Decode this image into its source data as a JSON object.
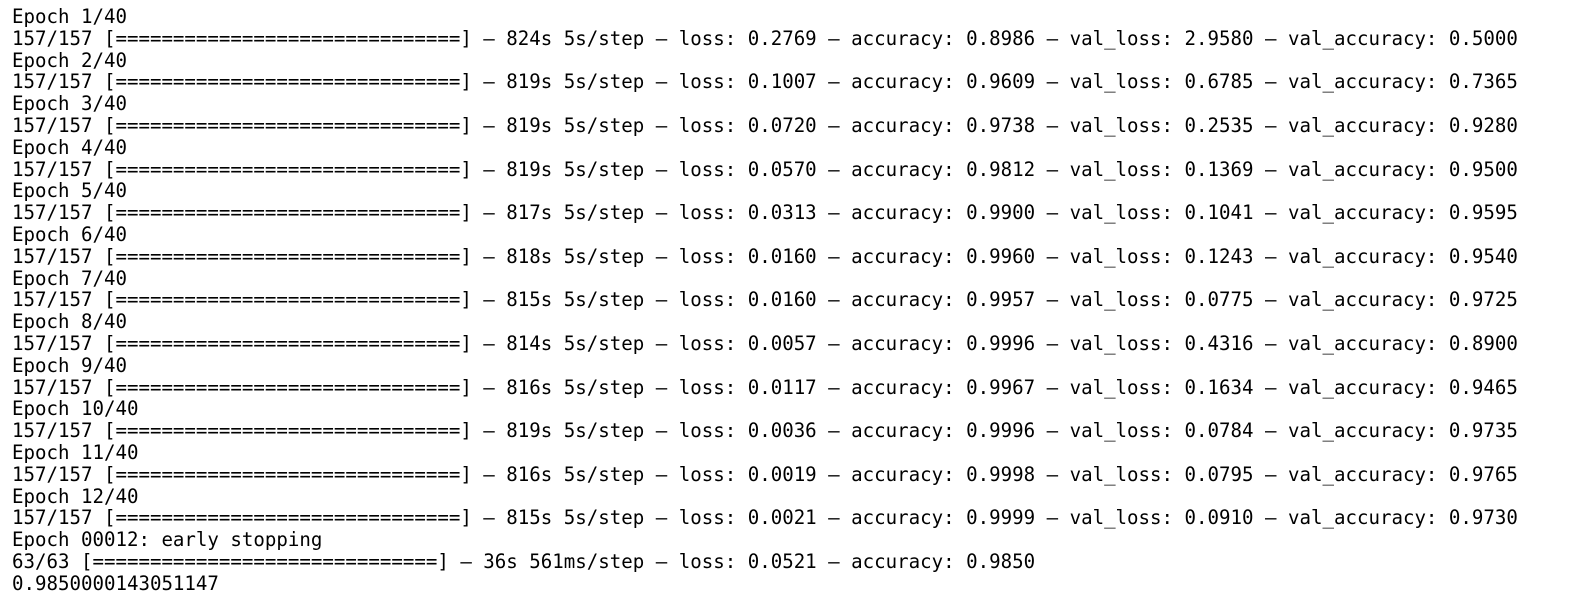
{
  "output": {
    "lines": [
      "Epoch 1/40",
      "157/157 [==============================] – 824s 5s/step – loss: 0.2769 – accuracy: 0.8986 – val_loss: 2.9580 – val_accuracy: 0.5000",
      "Epoch 2/40",
      "157/157 [==============================] – 819s 5s/step – loss: 0.1007 – accuracy: 0.9609 – val_loss: 0.6785 – val_accuracy: 0.7365",
      "Epoch 3/40",
      "157/157 [==============================] – 819s 5s/step – loss: 0.0720 – accuracy: 0.9738 – val_loss: 0.2535 – val_accuracy: 0.9280",
      "Epoch 4/40",
      "157/157 [==============================] – 819s 5s/step – loss: 0.0570 – accuracy: 0.9812 – val_loss: 0.1369 – val_accuracy: 0.9500",
      "Epoch 5/40",
      "157/157 [==============================] – 817s 5s/step – loss: 0.0313 – accuracy: 0.9900 – val_loss: 0.1041 – val_accuracy: 0.9595",
      "Epoch 6/40",
      "157/157 [==============================] – 818s 5s/step – loss: 0.0160 – accuracy: 0.9960 – val_loss: 0.1243 – val_accuracy: 0.9540",
      "Epoch 7/40",
      "157/157 [==============================] – 815s 5s/step – loss: 0.0160 – accuracy: 0.9957 – val_loss: 0.0775 – val_accuracy: 0.9725",
      "Epoch 8/40",
      "157/157 [==============================] – 814s 5s/step – loss: 0.0057 – accuracy: 0.9996 – val_loss: 0.4316 – val_accuracy: 0.8900",
      "Epoch 9/40",
      "157/157 [==============================] – 816s 5s/step – loss: 0.0117 – accuracy: 0.9967 – val_loss: 0.1634 – val_accuracy: 0.9465",
      "Epoch 10/40",
      "157/157 [==============================] – 819s 5s/step – loss: 0.0036 – accuracy: 0.9996 – val_loss: 0.0784 – val_accuracy: 0.9735",
      "Epoch 11/40",
      "157/157 [==============================] – 816s 5s/step – loss: 0.0019 – accuracy: 0.9998 – val_loss: 0.0795 – val_accuracy: 0.9765",
      "Epoch 12/40",
      "157/157 [==============================] – 815s 5s/step – loss: 0.0021 – accuracy: 0.9999 – val_loss: 0.0910 – val_accuracy: 0.9730",
      "Epoch 00012: early stopping",
      "63/63 [==============================] – 36s 561ms/step – loss: 0.0521 – accuracy: 0.9850",
      "0.9850000143051147"
    ]
  }
}
